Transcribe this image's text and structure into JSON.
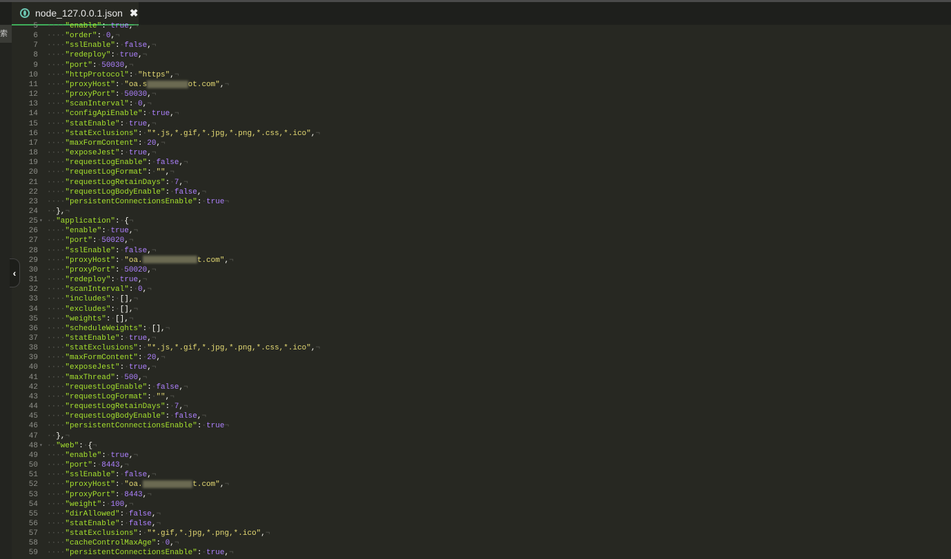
{
  "tab": {
    "title": "node_127.0.0.1.json",
    "close_icon": "close-icon",
    "logo_icon": "file-logo-icon"
  },
  "sidebar": {
    "search_label": "索",
    "collapse_icon": "chevron-left-icon"
  },
  "colors": {
    "key": "#a6e22e",
    "string": "#e6db74",
    "literal": "#ae81ff",
    "background": "#272822",
    "tab_accent": "#3fae5a"
  },
  "lines": [
    {
      "n": 5,
      "i": 2,
      "t": [
        [
          "k",
          "\"enable\""
        ],
        [
          "p",
          ": "
        ],
        [
          "n",
          "true"
        ],
        [
          "p",
          ","
        ]
      ]
    },
    {
      "n": 6,
      "i": 2,
      "t": [
        [
          "k",
          "\"order\""
        ],
        [
          "p",
          ": "
        ],
        [
          "n",
          "0"
        ],
        [
          "p",
          ","
        ]
      ]
    },
    {
      "n": 7,
      "i": 2,
      "t": [
        [
          "k",
          "\"sslEnable\""
        ],
        [
          "p",
          ": "
        ],
        [
          "n",
          "false"
        ],
        [
          "p",
          ","
        ]
      ]
    },
    {
      "n": 8,
      "i": 2,
      "t": [
        [
          "k",
          "\"redeploy\""
        ],
        [
          "p",
          ": "
        ],
        [
          "n",
          "true"
        ],
        [
          "p",
          ","
        ]
      ]
    },
    {
      "n": 9,
      "i": 2,
      "t": [
        [
          "k",
          "\"port\""
        ],
        [
          "p",
          ": "
        ],
        [
          "n",
          "50030"
        ],
        [
          "p",
          ","
        ]
      ]
    },
    {
      "n": 10,
      "i": 2,
      "t": [
        [
          "k",
          "\"httpProtocol\""
        ],
        [
          "p",
          ": "
        ],
        [
          "s",
          "\"https\""
        ],
        [
          "p",
          ","
        ]
      ]
    },
    {
      "n": 11,
      "i": 2,
      "t": [
        [
          "k",
          "\"proxyHost\""
        ],
        [
          "p",
          ": "
        ],
        [
          "s",
          "\"oa.s"
        ],
        [
          "b",
          "9"
        ],
        [
          "s",
          "ot.com\""
        ],
        [
          "p",
          ","
        ]
      ]
    },
    {
      "n": 12,
      "i": 2,
      "t": [
        [
          "k",
          "\"proxyPort\""
        ],
        [
          "p",
          ": "
        ],
        [
          "n",
          "50030"
        ],
        [
          "p",
          ","
        ]
      ]
    },
    {
      "n": 13,
      "i": 2,
      "t": [
        [
          "k",
          "\"scanInterval\""
        ],
        [
          "p",
          ": "
        ],
        [
          "n",
          "0"
        ],
        [
          "p",
          ","
        ]
      ]
    },
    {
      "n": 14,
      "i": 2,
      "t": [
        [
          "k",
          "\"configApiEnable\""
        ],
        [
          "p",
          ": "
        ],
        [
          "n",
          "true"
        ],
        [
          "p",
          ","
        ]
      ]
    },
    {
      "n": 15,
      "i": 2,
      "t": [
        [
          "k",
          "\"statEnable\""
        ],
        [
          "p",
          ": "
        ],
        [
          "n",
          "true"
        ],
        [
          "p",
          ","
        ]
      ]
    },
    {
      "n": 16,
      "i": 2,
      "t": [
        [
          "k",
          "\"statExclusions\""
        ],
        [
          "p",
          ": "
        ],
        [
          "s",
          "\"*.js,*.gif,*.jpg,*.png,*.css,*.ico\""
        ],
        [
          "p",
          ","
        ]
      ]
    },
    {
      "n": 17,
      "i": 2,
      "t": [
        [
          "k",
          "\"maxFormContent\""
        ],
        [
          "p",
          ": "
        ],
        [
          "n",
          "20"
        ],
        [
          "p",
          ","
        ]
      ]
    },
    {
      "n": 18,
      "i": 2,
      "t": [
        [
          "k",
          "\"exposeJest\""
        ],
        [
          "p",
          ": "
        ],
        [
          "n",
          "true"
        ],
        [
          "p",
          ","
        ]
      ]
    },
    {
      "n": 19,
      "i": 2,
      "t": [
        [
          "k",
          "\"requestLogEnable\""
        ],
        [
          "p",
          ": "
        ],
        [
          "n",
          "false"
        ],
        [
          "p",
          ","
        ]
      ]
    },
    {
      "n": 20,
      "i": 2,
      "t": [
        [
          "k",
          "\"requestLogFormat\""
        ],
        [
          "p",
          ": "
        ],
        [
          "s",
          "\"\""
        ],
        [
          "p",
          ","
        ]
      ]
    },
    {
      "n": 21,
      "i": 2,
      "t": [
        [
          "k",
          "\"requestLogRetainDays\""
        ],
        [
          "p",
          ": "
        ],
        [
          "n",
          "7"
        ],
        [
          "p",
          ","
        ]
      ]
    },
    {
      "n": 22,
      "i": 2,
      "t": [
        [
          "k",
          "\"requestLogBodyEnable\""
        ],
        [
          "p",
          ": "
        ],
        [
          "n",
          "false"
        ],
        [
          "p",
          ","
        ]
      ]
    },
    {
      "n": 23,
      "i": 2,
      "t": [
        [
          "k",
          "\"persistentConnectionsEnable\""
        ],
        [
          "p",
          ": "
        ],
        [
          "n",
          "true"
        ]
      ]
    },
    {
      "n": 24,
      "i": 1,
      "t": [
        [
          "p",
          "},"
        ]
      ]
    },
    {
      "n": 25,
      "i": 1,
      "f": true,
      "t": [
        [
          "k",
          "\"application\""
        ],
        [
          "p",
          ": {"
        ]
      ]
    },
    {
      "n": 26,
      "i": 2,
      "t": [
        [
          "k",
          "\"enable\""
        ],
        [
          "p",
          ": "
        ],
        [
          "n",
          "true"
        ],
        [
          "p",
          ","
        ]
      ]
    },
    {
      "n": 27,
      "i": 2,
      "t": [
        [
          "k",
          "\"port\""
        ],
        [
          "p",
          ": "
        ],
        [
          "n",
          "50020"
        ],
        [
          "p",
          ","
        ]
      ]
    },
    {
      "n": 28,
      "i": 2,
      "t": [
        [
          "k",
          "\"sslEnable\""
        ],
        [
          "p",
          ": "
        ],
        [
          "n",
          "false"
        ],
        [
          "p",
          ","
        ]
      ]
    },
    {
      "n": 29,
      "i": 2,
      "t": [
        [
          "k",
          "\"proxyHost\""
        ],
        [
          "p",
          ": "
        ],
        [
          "s",
          "\"oa."
        ],
        [
          "b",
          "12"
        ],
        [
          "s",
          "t.com\""
        ],
        [
          "p",
          ","
        ]
      ]
    },
    {
      "n": 30,
      "i": 2,
      "t": [
        [
          "k",
          "\"proxyPort\""
        ],
        [
          "p",
          ": "
        ],
        [
          "n",
          "50020"
        ],
        [
          "p",
          ","
        ]
      ]
    },
    {
      "n": 31,
      "i": 2,
      "t": [
        [
          "k",
          "\"redeploy\""
        ],
        [
          "p",
          ": "
        ],
        [
          "n",
          "true"
        ],
        [
          "p",
          ","
        ]
      ]
    },
    {
      "n": 32,
      "i": 2,
      "t": [
        [
          "k",
          "\"scanInterval\""
        ],
        [
          "p",
          ": "
        ],
        [
          "n",
          "0"
        ],
        [
          "p",
          ","
        ]
      ]
    },
    {
      "n": 33,
      "i": 2,
      "t": [
        [
          "k",
          "\"includes\""
        ],
        [
          "p",
          ": [],"
        ]
      ]
    },
    {
      "n": 34,
      "i": 2,
      "t": [
        [
          "k",
          "\"excludes\""
        ],
        [
          "p",
          ": [],"
        ]
      ]
    },
    {
      "n": 35,
      "i": 2,
      "t": [
        [
          "k",
          "\"weights\""
        ],
        [
          "p",
          ": [],"
        ]
      ]
    },
    {
      "n": 36,
      "i": 2,
      "t": [
        [
          "k",
          "\"scheduleWeights\""
        ],
        [
          "p",
          ": [],"
        ]
      ]
    },
    {
      "n": 37,
      "i": 2,
      "t": [
        [
          "k",
          "\"statEnable\""
        ],
        [
          "p",
          ": "
        ],
        [
          "n",
          "true"
        ],
        [
          "p",
          ","
        ]
      ]
    },
    {
      "n": 38,
      "i": 2,
      "t": [
        [
          "k",
          "\"statExclusions\""
        ],
        [
          "p",
          ": "
        ],
        [
          "s",
          "\"*.js,*.gif,*.jpg,*.png,*.css,*.ico\""
        ],
        [
          "p",
          ","
        ]
      ]
    },
    {
      "n": 39,
      "i": 2,
      "t": [
        [
          "k",
          "\"maxFormContent\""
        ],
        [
          "p",
          ": "
        ],
        [
          "n",
          "20"
        ],
        [
          "p",
          ","
        ]
      ]
    },
    {
      "n": 40,
      "i": 2,
      "t": [
        [
          "k",
          "\"exposeJest\""
        ],
        [
          "p",
          ": "
        ],
        [
          "n",
          "true"
        ],
        [
          "p",
          ","
        ]
      ]
    },
    {
      "n": 41,
      "i": 2,
      "t": [
        [
          "k",
          "\"maxThread\""
        ],
        [
          "p",
          ": "
        ],
        [
          "n",
          "500"
        ],
        [
          "p",
          ","
        ]
      ]
    },
    {
      "n": 42,
      "i": 2,
      "t": [
        [
          "k",
          "\"requestLogEnable\""
        ],
        [
          "p",
          ": "
        ],
        [
          "n",
          "false"
        ],
        [
          "p",
          ","
        ]
      ]
    },
    {
      "n": 43,
      "i": 2,
      "t": [
        [
          "k",
          "\"requestLogFormat\""
        ],
        [
          "p",
          ": "
        ],
        [
          "s",
          "\"\""
        ],
        [
          "p",
          ","
        ]
      ]
    },
    {
      "n": 44,
      "i": 2,
      "t": [
        [
          "k",
          "\"requestLogRetainDays\""
        ],
        [
          "p",
          ": "
        ],
        [
          "n",
          "7"
        ],
        [
          "p",
          ","
        ]
      ]
    },
    {
      "n": 45,
      "i": 2,
      "t": [
        [
          "k",
          "\"requestLogBodyEnable\""
        ],
        [
          "p",
          ": "
        ],
        [
          "n",
          "false"
        ],
        [
          "p",
          ","
        ]
      ]
    },
    {
      "n": 46,
      "i": 2,
      "t": [
        [
          "k",
          "\"persistentConnectionsEnable\""
        ],
        [
          "p",
          ": "
        ],
        [
          "n",
          "true"
        ]
      ]
    },
    {
      "n": 47,
      "i": 1,
      "t": [
        [
          "p",
          "},"
        ]
      ]
    },
    {
      "n": 48,
      "i": 1,
      "f": true,
      "t": [
        [
          "k",
          "\"web\""
        ],
        [
          "p",
          ": {"
        ]
      ]
    },
    {
      "n": 49,
      "i": 2,
      "t": [
        [
          "k",
          "\"enable\""
        ],
        [
          "p",
          ": "
        ],
        [
          "n",
          "true"
        ],
        [
          "p",
          ","
        ]
      ]
    },
    {
      "n": 50,
      "i": 2,
      "t": [
        [
          "k",
          "\"port\""
        ],
        [
          "p",
          ": "
        ],
        [
          "n",
          "8443"
        ],
        [
          "p",
          ","
        ]
      ]
    },
    {
      "n": 51,
      "i": 2,
      "t": [
        [
          "k",
          "\"sslEnable\""
        ],
        [
          "p",
          ": "
        ],
        [
          "n",
          "false"
        ],
        [
          "p",
          ","
        ]
      ]
    },
    {
      "n": 52,
      "i": 2,
      "t": [
        [
          "k",
          "\"proxyHost\""
        ],
        [
          "p",
          ": "
        ],
        [
          "s",
          "\"oa."
        ],
        [
          "b",
          "11"
        ],
        [
          "s",
          "t.com\""
        ],
        [
          "p",
          ","
        ]
      ]
    },
    {
      "n": 53,
      "i": 2,
      "t": [
        [
          "k",
          "\"proxyPort\""
        ],
        [
          "p",
          ": "
        ],
        [
          "n",
          "8443"
        ],
        [
          "p",
          ","
        ]
      ]
    },
    {
      "n": 54,
      "i": 2,
      "t": [
        [
          "k",
          "\"weight\""
        ],
        [
          "p",
          ": "
        ],
        [
          "n",
          "100"
        ],
        [
          "p",
          ","
        ]
      ]
    },
    {
      "n": 55,
      "i": 2,
      "t": [
        [
          "k",
          "\"dirAllowed\""
        ],
        [
          "p",
          ": "
        ],
        [
          "n",
          "false"
        ],
        [
          "p",
          ","
        ]
      ]
    },
    {
      "n": 56,
      "i": 2,
      "t": [
        [
          "k",
          "\"statEnable\""
        ],
        [
          "p",
          ": "
        ],
        [
          "n",
          "false"
        ],
        [
          "p",
          ","
        ]
      ]
    },
    {
      "n": 57,
      "i": 2,
      "t": [
        [
          "k",
          "\"statExclusions\""
        ],
        [
          "p",
          ": "
        ],
        [
          "s",
          "\"*.gif,*.jpg,*.png,*.ico\""
        ],
        [
          "p",
          ","
        ]
      ]
    },
    {
      "n": 58,
      "i": 2,
      "t": [
        [
          "k",
          "\"cacheControlMaxAge\""
        ],
        [
          "p",
          ": "
        ],
        [
          "n",
          "0"
        ],
        [
          "p",
          ","
        ]
      ]
    },
    {
      "n": 59,
      "i": 2,
      "t": [
        [
          "k",
          "\"persistentConnectionsEnable\""
        ],
        [
          "p",
          ": "
        ],
        [
          "n",
          "true"
        ],
        [
          "p",
          ","
        ]
      ]
    }
  ]
}
